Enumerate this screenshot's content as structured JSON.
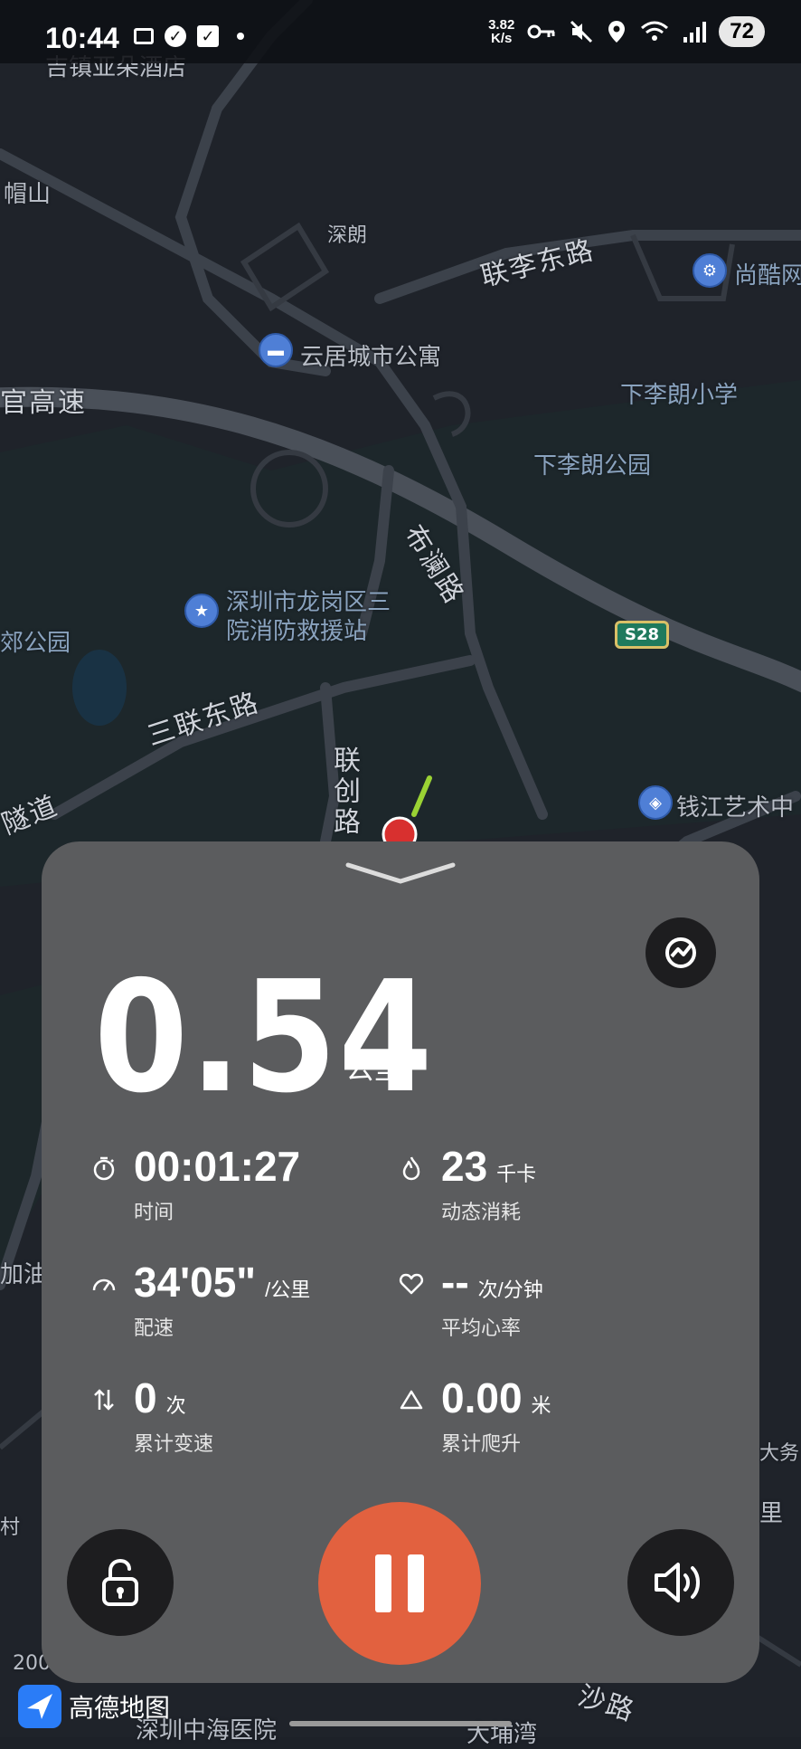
{
  "status_bar": {
    "time": "10:44",
    "net_speed_value": "3.82",
    "net_speed_unit": "K/s",
    "battery": "72",
    "icons": [
      "notification-icon",
      "check-icon",
      "key-icon",
      "mute-icon",
      "location-icon",
      "wifi-icon",
      "signal-icon"
    ]
  },
  "map": {
    "labels": {
      "top_left": "吉镇亚朵酒店",
      "maoshan": "帽山",
      "shenlang": "深朗",
      "lianli_road": "联李东路",
      "shangku": "尚酷网",
      "yunju": "云居城市公寓",
      "xialilang_school": "下李朗小学",
      "gaosu": "官高速",
      "xialilang_park": "下李朗公园",
      "buling_road": "布澜路",
      "fire_station": "深圳市龙岗区三院消防救援站",
      "park_left": "郊公园",
      "highway_shield": "S28",
      "sanlian_road": "三联东路",
      "lianchuang_road": "联创路",
      "tunnel": "隧道",
      "qianjiang": "钱江艺术中",
      "oil": "加油",
      "village": "村",
      "dafu": "大务",
      "li": "里",
      "shalu": "沙路",
      "hospital": "深圳中海医院",
      "dapaisha": "大埔湾",
      "scale": "200"
    },
    "brand": "高德地图"
  },
  "panel": {
    "distance": "0.54",
    "distance_unit": "公里",
    "stats": {
      "time": {
        "value": "00:01:27",
        "unit": "",
        "label": "时间"
      },
      "calories": {
        "value": "23",
        "unit": "千卡",
        "label": "动态消耗"
      },
      "pace": {
        "value": "34'05\"",
        "unit": "/公里",
        "label": "配速"
      },
      "heart_rate": {
        "value": "--",
        "unit": "次/分钟",
        "label": "平均心率"
      },
      "speed_changes": {
        "value": "0",
        "unit": "次",
        "label": "累计变速"
      },
      "elevation": {
        "value": "0.00",
        "unit": "米",
        "label": "累计爬升"
      }
    }
  },
  "colors": {
    "panel_bg": "#5b5c5e",
    "pause_accent": "#e2613f",
    "dark_button": "#1d1d1f",
    "map_bg": "#1d2128"
  }
}
